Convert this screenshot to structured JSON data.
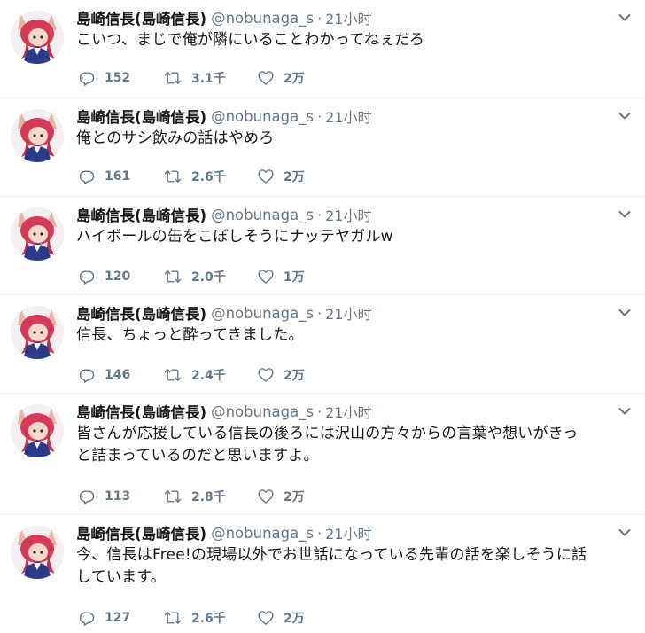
{
  "tweets": [
    {
      "name": "島崎信長(島崎信長)",
      "handle": "@nobunaga_s",
      "separator": "·",
      "time": "21小时",
      "text_lines": [
        "こいつ、まじで俺が隣にいることわかってねぇだろ"
      ],
      "reply_count": "152",
      "retweet_count": "3.1千",
      "like_count": "2万"
    },
    {
      "name": "島崎信長(島崎信長)",
      "handle": "@nobunaga_s",
      "separator": "·",
      "time": "21小时",
      "text_lines": [
        "俺とのサシ飲みの話はやめろ"
      ],
      "reply_count": "161",
      "retweet_count": "2.6千",
      "like_count": "2万"
    },
    {
      "name": "島崎信長(島崎信長)",
      "handle": "@nobunaga_s",
      "separator": "·",
      "time": "21小时",
      "text_lines": [
        "ハイボールの缶をこぼしそうにナッテヤガルw"
      ],
      "reply_count": "120",
      "retweet_count": "2.0千",
      "like_count": "1万"
    },
    {
      "name": "島崎信長(島崎信長)",
      "handle": "@nobunaga_s",
      "separator": "·",
      "time": "21小时",
      "text_lines": [
        "信長、ちょっと酔ってきました。"
      ],
      "reply_count": "146",
      "retweet_count": "2.4千",
      "like_count": "2万"
    },
    {
      "name": "島崎信長(島崎信長)",
      "handle": "@nobunaga_s",
      "separator": "·",
      "time": "21小时",
      "text_lines": [
        "皆さんが応援している信長の後ろには沢山の方々からの言葉や想いがきっ",
        "と詰まっているのだと思いますよ。"
      ],
      "reply_count": "113",
      "retweet_count": "2.8千",
      "like_count": "2万"
    },
    {
      "name": "島崎信長(島崎信長)",
      "handle": "@nobunaga_s",
      "separator": "·",
      "time": "21小时",
      "text_lines": [
        "今、信長はFree!の現場以外でお世話になっている先輩の話を楽しそうに話",
        "しています。"
      ],
      "reply_count": "127",
      "retweet_count": "2.6千",
      "like_count": "2万"
    }
  ],
  "icons": {
    "avatar": "avatar-image",
    "caret": "chevron-down-icon",
    "reply": "reply-icon",
    "retweet": "retweet-icon",
    "like": "heart-icon"
  },
  "colors": {
    "text": "#14171a",
    "muted": "#657786",
    "divider": "#e6ecf0",
    "background": "#ffffff"
  }
}
